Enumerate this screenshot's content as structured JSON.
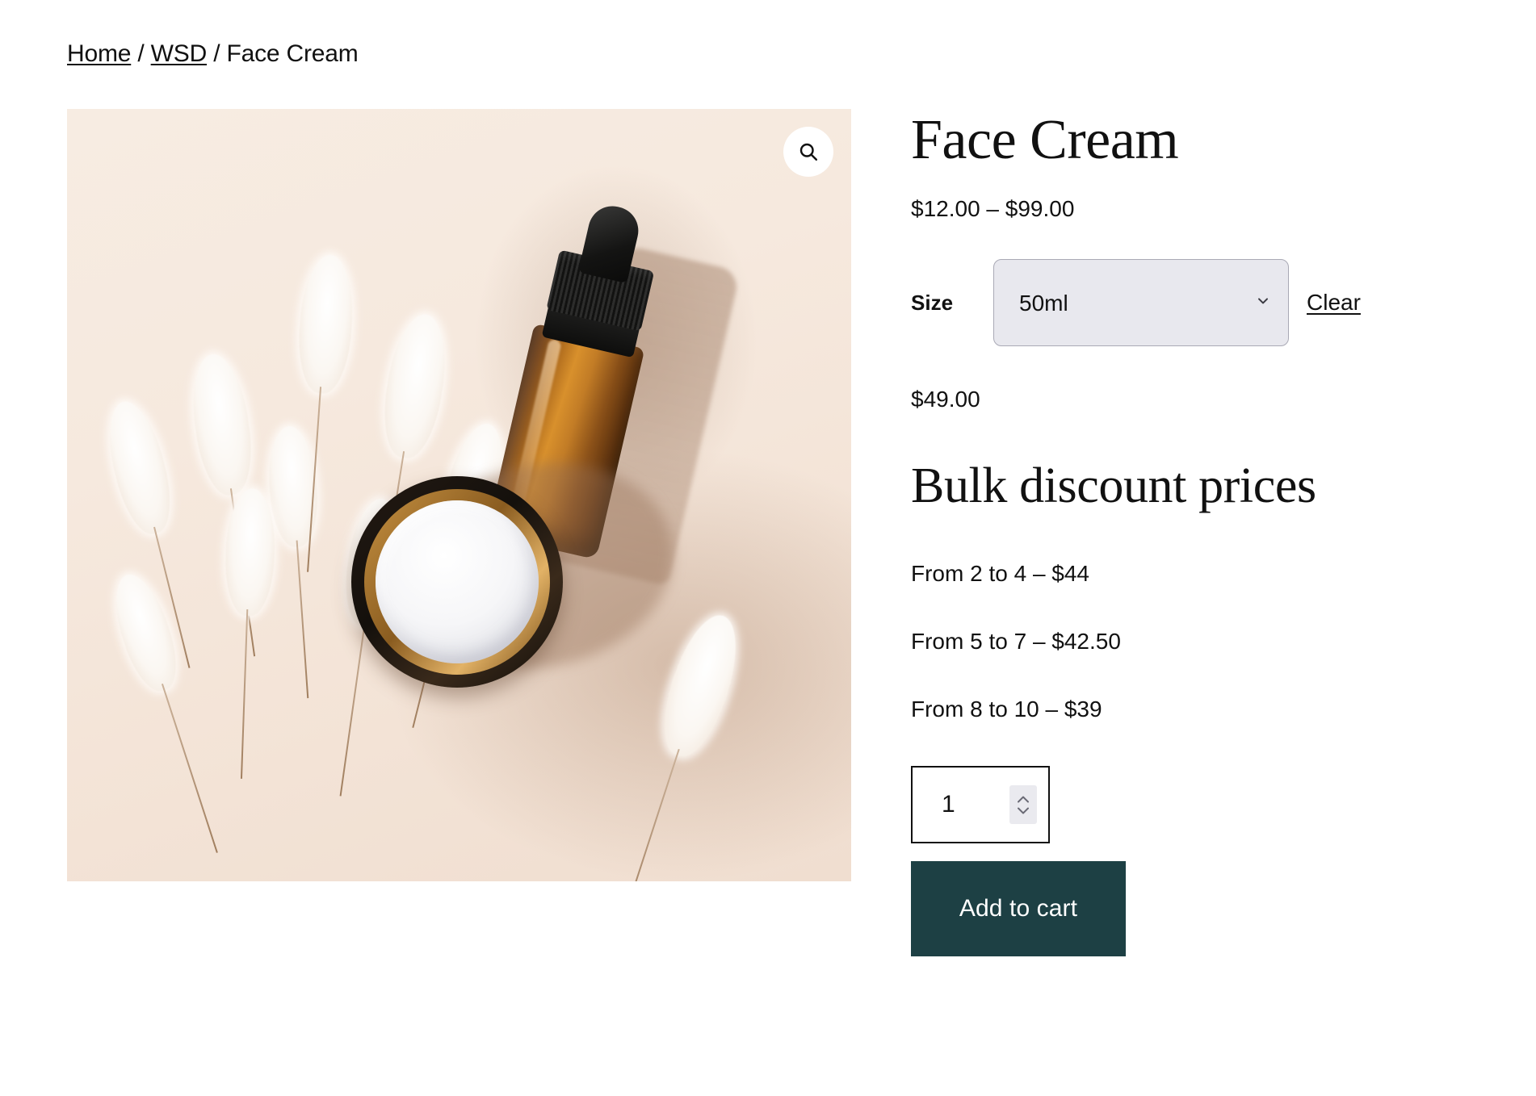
{
  "breadcrumb": {
    "home": "Home",
    "category": "WSD",
    "current": "Face Cream",
    "separator": "/"
  },
  "gallery": {
    "zoom_icon": "search-icon",
    "image_alt": "Face Cream product photo with amber dropper bottle, cream jar and bunny tail grasses"
  },
  "product": {
    "title": "Face Cream",
    "price_range": "$12.00 – $99.00",
    "selected_price": "$49.00"
  },
  "variations": {
    "attribute_label": "Size",
    "selected_value": "50ml",
    "options": [
      "50ml"
    ],
    "clear_label": "Clear",
    "caret_icon": "chevron-down-icon"
  },
  "bulk": {
    "heading": "Bulk discount prices",
    "rows": [
      "From 2 to 4 – $44",
      "From 5 to 7 – $42.50",
      "From 8 to 10 – $39"
    ]
  },
  "cart": {
    "quantity": "1",
    "quantity_placeholder": "1",
    "spinner_up_icon": "chevron-up-icon",
    "spinner_down_icon": "chevron-down-icon",
    "add_to_cart_label": "Add to cart"
  },
  "colors": {
    "accent_button": "#1d4044",
    "select_background": "#e8e8ee",
    "select_border": "#a9a9b5",
    "text": "#111111",
    "image_background": "#f4e8dd"
  }
}
